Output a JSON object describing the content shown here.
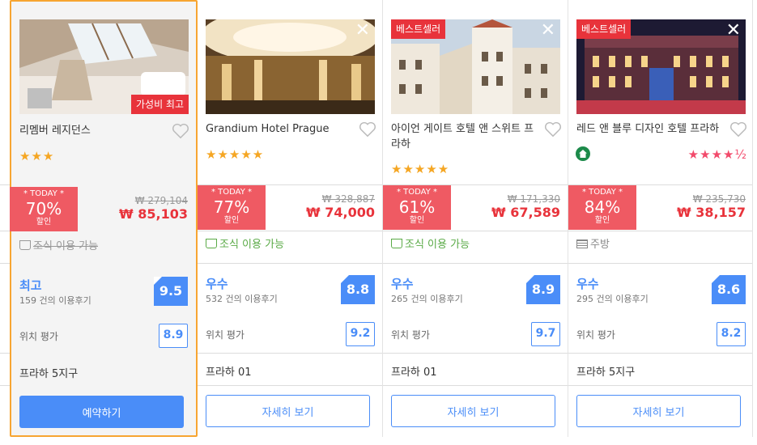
{
  "hotels": [
    {
      "name": "리멤버 레지던스",
      "badge": "가성비 최고",
      "stars": "★★★",
      "deal_today": "* TODAY *",
      "deal_pct": "70%",
      "deal_off": "할인",
      "orig_price": "₩ 279,104",
      "price": "₩ 85,103",
      "amenity": "조식 이용 가능",
      "grade": "최고",
      "reviews": "159 건의 이용후기",
      "score": "9.5",
      "loc_label": "위치 평가",
      "loc_score": "8.9",
      "district": "프라하 5지구",
      "button": "예약하기"
    },
    {
      "name": "Grandium Hotel Prague",
      "close": "✕",
      "stars": "★★★★★",
      "deal_today": "* TODAY *",
      "deal_pct": "77%",
      "deal_off": "할인",
      "orig_price": "₩ 328,887",
      "price": "₩ 74,000",
      "amenity": "조식 이용 가능",
      "grade": "우수",
      "reviews": "532 건의 이용후기",
      "score": "8.8",
      "loc_label": "위치 평가",
      "loc_score": "9.2",
      "district": "프라하 01",
      "button": "자세히 보기"
    },
    {
      "name": "아이언 게이트 호텔 앤 스위트 프라하",
      "badge": "베스트셀러",
      "close": "✕",
      "stars": "★★★★★",
      "deal_today": "* TODAY *",
      "deal_pct": "61%",
      "deal_off": "할인",
      "orig_price": "₩ 171,330",
      "price": "₩ 67,589",
      "amenity": "조식 이용 가능",
      "grade": "우수",
      "reviews": "265 건의 이용후기",
      "score": "8.9",
      "loc_label": "위치 평가",
      "loc_score": "9.7",
      "district": "프라하 01",
      "button": "자세히 보기"
    },
    {
      "name": "레드 앤 블루 디자인 호텔 프라하",
      "badge": "베스트셀러",
      "close": "✕",
      "stars": "★★★★½",
      "deal_today": "* TODAY *",
      "deal_pct": "84%",
      "deal_off": "할인",
      "orig_price": "₩ 235,730",
      "price": "₩ 38,157",
      "amenity": "주방",
      "grade": "우수",
      "reviews": "295 건의 이용후기",
      "score": "8.6",
      "loc_label": "위치 평가",
      "loc_score": "8.2",
      "district": "프라하 5지구",
      "button": "자세히 보기"
    }
  ],
  "colors": {
    "accent_blue": "#4a8df8",
    "deal_red": "#ef5a63",
    "price_red": "#e8333b",
    "featured_border": "#f7a531",
    "amenity_green": "#5aaa46"
  }
}
